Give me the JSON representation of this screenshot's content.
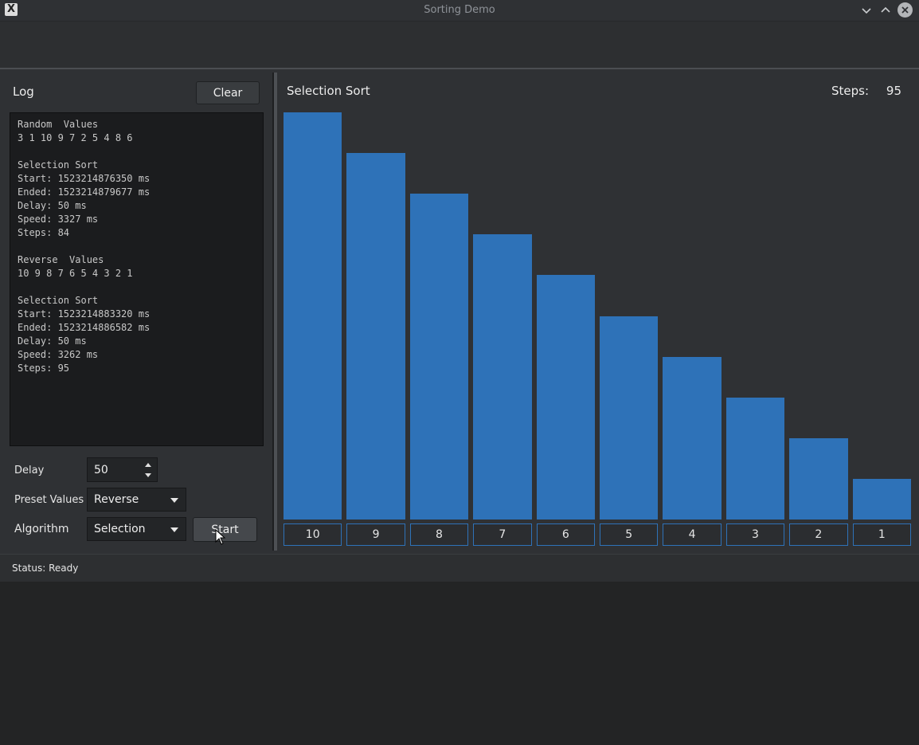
{
  "window": {
    "title": "Sorting Demo",
    "app_icon": "x-app-icon"
  },
  "left": {
    "log_label": "Log",
    "clear_label": "Clear",
    "log_text": "Random  Values\n3 1 10 9 7 2 5 4 8 6\n\nSelection Sort\nStart: 1523214876350 ms\nEnded: 1523214879677 ms\nDelay: 50 ms\nSpeed: 3327 ms\nSteps: 84\n\nReverse  Values\n10 9 8 7 6 5 4 3 2 1\n\nSelection Sort\nStart: 1523214883320 ms\nEnded: 1523214886582 ms\nDelay: 50 ms\nSpeed: 3262 ms\nSteps: 95",
    "delay_label": "Delay",
    "delay_value": "50",
    "preset_label": "Preset Values",
    "preset_value": "Reverse",
    "algorithm_label": "Algorithm",
    "algorithm_value": "Selection",
    "start_label": "Start"
  },
  "chart": {
    "title": "Selection Sort",
    "steps_label": "Steps:",
    "steps_value": "95",
    "bar_color": "#2e72b8"
  },
  "chart_data": {
    "type": "bar",
    "categories": [
      "10",
      "9",
      "8",
      "7",
      "6",
      "5",
      "4",
      "3",
      "2",
      "1"
    ],
    "values": [
      10,
      9,
      8,
      7,
      6,
      5,
      4,
      3,
      2,
      1
    ],
    "title": "Selection Sort",
    "xlabel": "",
    "ylabel": "",
    "ylim": [
      0,
      10
    ],
    "grid": false
  },
  "status": {
    "text": "Status: Ready"
  }
}
